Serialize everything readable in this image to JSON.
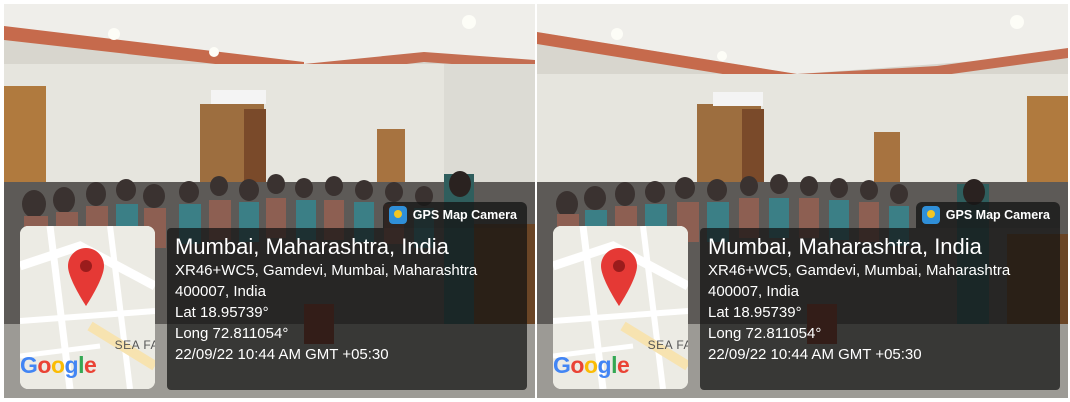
{
  "photos": [
    {
      "badge_label": "GPS Map Camera",
      "location_title": "Mumbai, Maharashtra, India",
      "address_line1": "XR46+WC5, Gamdevi, Mumbai, Maharashtra",
      "address_line2": "400007, India",
      "latitude": "Lat 18.95739°",
      "longitude": "Long 72.811054°",
      "timestamp": "22/09/22 10:44 AM GMT +05:30",
      "map_label": "SEA FA",
      "map_brand": "Google",
      "icons": [
        "gps-map-camera-icon",
        "location-pin-icon"
      ]
    },
    {
      "badge_label": "GPS Map Camera",
      "location_title": "Mumbai, Maharashtra, India",
      "address_line1": "XR46+WC5, Gamdevi, Mumbai, Maharashtra",
      "address_line2": "400007, India",
      "latitude": "Lat 18.95739°",
      "longitude": "Long 72.811054°",
      "timestamp": "22/09/22 10:44 AM GMT +05:30",
      "map_label": "SEA FA",
      "map_brand": "Google",
      "icons": [
        "gps-map-camera-icon",
        "location-pin-icon"
      ]
    }
  ],
  "colors": {
    "overlay": "#121212",
    "pin": "#e53935",
    "google_blue": "#4285F4",
    "google_red": "#EA4335",
    "google_yellow": "#FBBC05",
    "google_green": "#34A853"
  }
}
